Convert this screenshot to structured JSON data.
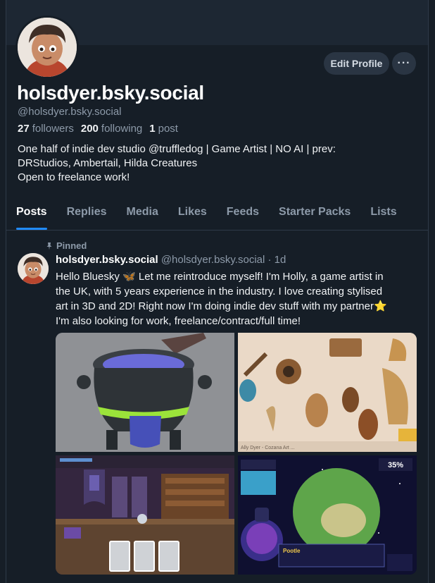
{
  "profile": {
    "display_name": "holsdyer.bsky.social",
    "handle": "@holsdyer.bsky.social",
    "followers_count": "27",
    "followers_label": "followers",
    "following_count": "200",
    "following_label": "following",
    "posts_count": "1",
    "posts_label": "post",
    "bio_lines": [
      "One half of indie dev studio @truffledog | Game Artist | NO AI | prev:",
      "DRStudios, Ambertail, Hilda Creatures",
      "Open to freelance work!"
    ],
    "edit_label": "Edit Profile",
    "more_label": "···"
  },
  "tabs": [
    "Posts",
    "Replies",
    "Media",
    "Likes",
    "Feeds",
    "Starter Packs",
    "Lists"
  ],
  "post": {
    "pinned_label": "Pinned",
    "author_name": "holsdyer.bsky.social",
    "author_handle": "@holsdyer.bsky.social · 1d",
    "text_lines": [
      "Hello Bluesky 🦋 Let me reintroduce myself! I'm Holly, a game artist in",
      "the UK, with 5 years experience in the industry. I love creating stylised",
      "art in 3D and 2D! Right now I'm doing indie dev stuff with my partner⭐",
      "I'm also looking for work, freelance/contract/full time!"
    ],
    "image3_caption": "Ally Dyer - Cozana Art ...",
    "image4_badge": "35%",
    "image4_name": "Pootle"
  },
  "colors": {
    "background": "#161e27",
    "accent": "#208bfe",
    "muted": "#8d9aa9"
  }
}
